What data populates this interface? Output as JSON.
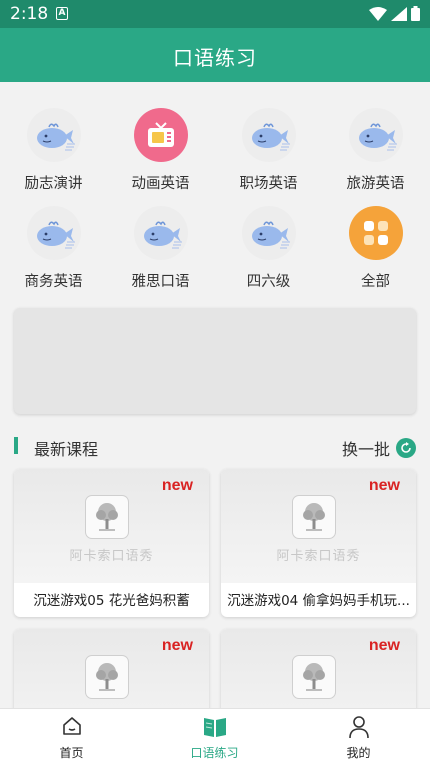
{
  "status": {
    "time": "2:18",
    "notif_glyph": "A"
  },
  "appbar": {
    "title": "口语练习"
  },
  "categories": [
    {
      "label": "励志演讲",
      "icon": "whale-icon"
    },
    {
      "label": "动画英语",
      "icon": "tv-icon"
    },
    {
      "label": "职场英语",
      "icon": "whale-icon"
    },
    {
      "label": "旅游英语",
      "icon": "whale-icon"
    },
    {
      "label": "商务英语",
      "icon": "whale-icon"
    },
    {
      "label": "雅思口语",
      "icon": "whale-icon"
    },
    {
      "label": "四六级",
      "icon": "whale-icon"
    },
    {
      "label": "全部",
      "icon": "grid-icon"
    }
  ],
  "section": {
    "title": "最新课程",
    "refresh_label": "换一批"
  },
  "courses": [
    {
      "badge": "new",
      "brand": "阿卡索口语秀",
      "title": "沉迷游戏05 花光爸妈积蓄"
    },
    {
      "badge": "new",
      "brand": "阿卡索口语秀",
      "title": "沉迷游戏04 偷拿妈妈手机玩..."
    },
    {
      "badge": "new",
      "brand": "",
      "title": ""
    },
    {
      "badge": "new",
      "brand": "",
      "title": ""
    }
  ],
  "tabs": [
    {
      "label": "首页",
      "icon": "home-icon"
    },
    {
      "label": "口语练习",
      "icon": "book-icon"
    },
    {
      "label": "我的",
      "icon": "person-icon"
    }
  ],
  "colors": {
    "primary": "#2aa886",
    "statusbar": "#1f8a6b",
    "new_badge": "#d92323",
    "tv_icon_bg": "#f06a8c",
    "all_icon_bg": "#f5a33a"
  }
}
